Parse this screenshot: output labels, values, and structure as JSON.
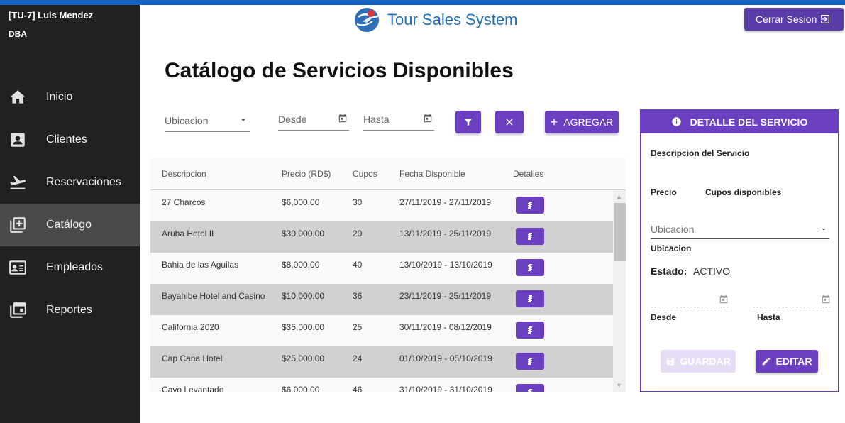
{
  "app": {
    "title": "Tour Sales System"
  },
  "user": {
    "name": "[TU-7] Luis Mendez",
    "role": "DBA"
  },
  "header": {
    "logout_label": "Cerrar Sesion"
  },
  "sidebar": {
    "items": [
      {
        "label": "Inicio",
        "icon": "home-icon",
        "active": false
      },
      {
        "label": "Clientes",
        "icon": "contact-icon",
        "active": false
      },
      {
        "label": "Reservaciones",
        "icon": "flight-icon",
        "active": false
      },
      {
        "label": "Catálogo",
        "icon": "library-add-icon",
        "active": true
      },
      {
        "label": "Empleados",
        "icon": "badge-icon",
        "active": false
      },
      {
        "label": "Reportes",
        "icon": "calendar-icon",
        "active": false
      }
    ]
  },
  "page": {
    "title": "Catálogo de Servicios Disponibles"
  },
  "filters": {
    "ubicacion_label": "Ubicacion",
    "desde_label": "Desde",
    "hasta_label": "Hasta",
    "add_label": "AGREGAR"
  },
  "table": {
    "columns": [
      "Descripcion",
      "Precio (RD$)",
      "Cupos",
      "Fecha Disponible",
      "Detalles"
    ],
    "rows": [
      {
        "descripcion": "27 Charcos",
        "precio": "$6,000.00",
        "cupos": "30",
        "fecha": "27/11/2019 - 27/11/2019"
      },
      {
        "descripcion": "Aruba Hotel II",
        "precio": "$30,000.00",
        "cupos": "20",
        "fecha": "13/11/2019 - 25/11/2019"
      },
      {
        "descripcion": "Bahia de las Aguilas",
        "precio": "$8,000.00",
        "cupos": "40",
        "fecha": "13/10/2019 - 13/10/2019"
      },
      {
        "descripcion": "Bayahibe Hotel and Casino",
        "precio": "$10,000.00",
        "cupos": "36",
        "fecha": "23/11/2019 - 25/11/2019"
      },
      {
        "descripcion": "California 2020",
        "precio": "$35,000.00",
        "cupos": "25",
        "fecha": "30/11/2019 - 08/12/2019"
      },
      {
        "descripcion": "Cap Cana Hotel",
        "precio": "$25,000.00",
        "cupos": "24",
        "fecha": "01/10/2019 - 05/10/2019"
      },
      {
        "descripcion": "Cayo Levantado",
        "precio": "$6,000.00",
        "cupos": "46",
        "fecha": "31/10/2019 - 31/10/2019"
      }
    ]
  },
  "detail": {
    "header": "DETALLE DEL SERVICIO",
    "descripcion_label": "Descripcion del Servicio",
    "precio_label": "Precio",
    "cupos_label": "Cupos disponibles",
    "ubicacion_placeholder": "Ubicacion",
    "ubicacion_label": "Ubicacion",
    "estado_label": "Estado:",
    "estado_value": "ACTIVO",
    "desde_label": "Desde",
    "hasta_label": "Hasta",
    "save_label": "GUARDAR",
    "edit_label": "EDITAR"
  },
  "colors": {
    "accent": "#6a3fc0",
    "sidebar": "#212121",
    "topbar": "#1565c0",
    "brand_text": "#1f6fb8"
  }
}
